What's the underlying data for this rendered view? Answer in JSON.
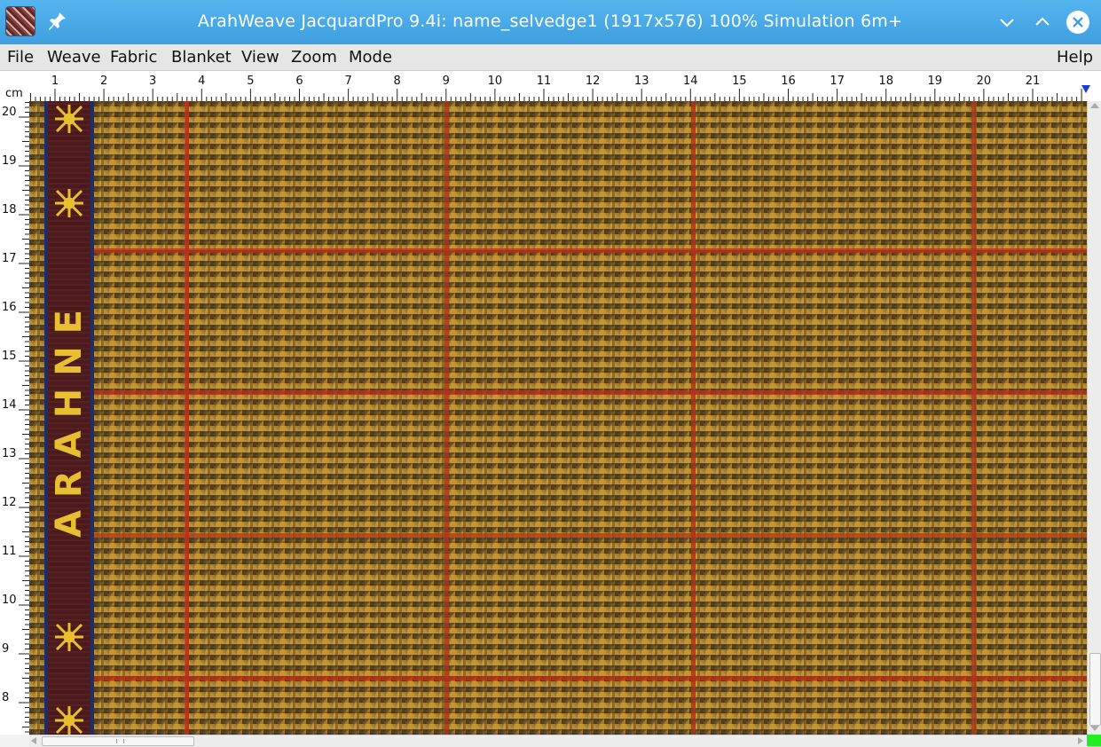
{
  "window": {
    "title": "ArahWeave JacquardPro 9.4i: name_selvedge1 (1917x576) 100% Simulation 6m+",
    "controls": [
      "minimize-icon",
      "maximize-icon",
      "close-icon"
    ]
  },
  "menu": {
    "items": [
      "File",
      "Weave",
      "Fabric",
      "Blanket",
      "View",
      "Zoom",
      "Mode"
    ],
    "help": "Help"
  },
  "ruler": {
    "unit": "cm",
    "horizontal_labels": [
      "1",
      "2",
      "3",
      "4",
      "5",
      "6",
      "7",
      "8",
      "9",
      "10",
      "11",
      "12",
      "13",
      "14",
      "15",
      "16",
      "17",
      "18",
      "19",
      "20",
      "21"
    ],
    "vertical_labels": [
      "20",
      "19",
      "18",
      "17",
      "16",
      "15",
      "14",
      "13",
      "12",
      "11",
      "10",
      "9",
      "8"
    ]
  },
  "selvedge": {
    "text": "ARAHNE",
    "colors": {
      "band": "#4a1a1c",
      "letters": "#e6c030",
      "edge": "#1c2e6a"
    }
  },
  "fabric": {
    "pattern": "houndstooth-with-windowpane-check",
    "colors": {
      "base": "#9a7a2a",
      "gold": "#c7962e",
      "dark": "#3b2616",
      "olive": "#6d5a2c",
      "check": "#b8301a"
    }
  },
  "accent": "#3fa3e6",
  "status_indicator_color": "#22ee22"
}
